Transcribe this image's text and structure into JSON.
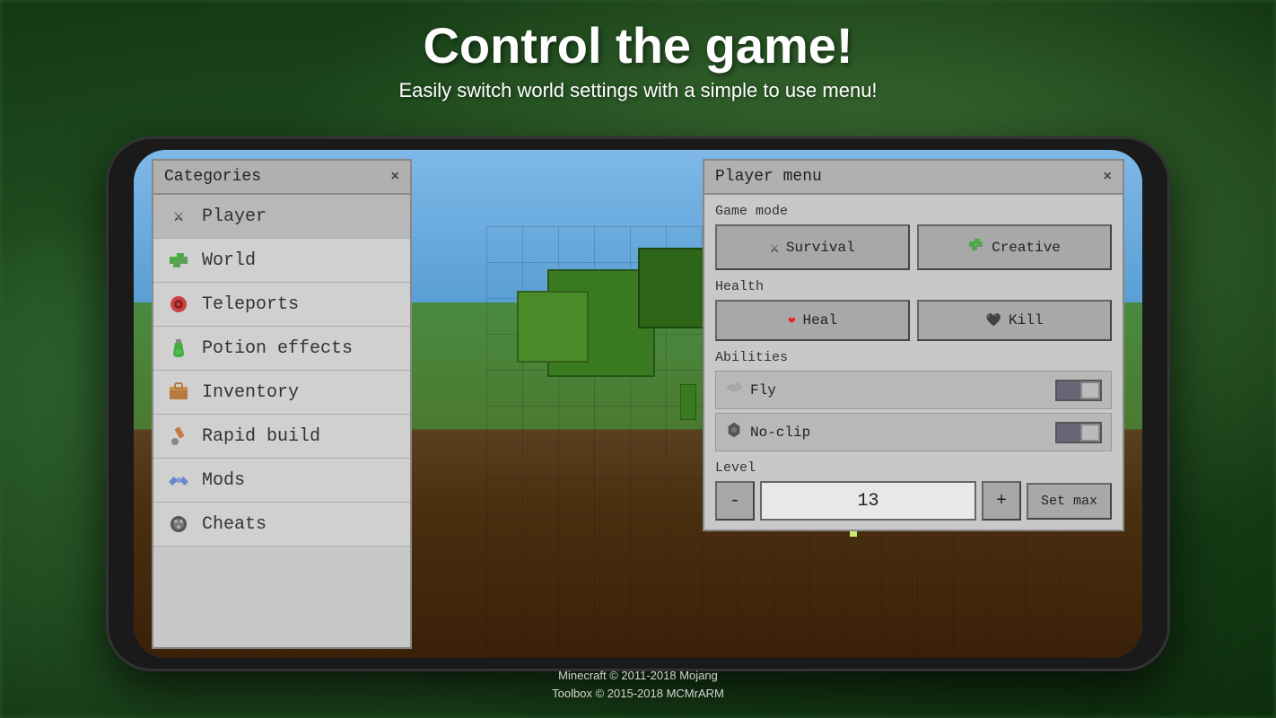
{
  "page": {
    "title": "Control the game!",
    "subtitle": "Easily switch world settings with a simple to use menu!",
    "footer_line1": "Minecraft © 2011-2018 Mojang",
    "footer_line2": "Toolbox © 2015-2018 MCMrARM"
  },
  "categories_panel": {
    "title": "Categories",
    "close": "×",
    "items": [
      {
        "id": "player",
        "label": "Player",
        "icon": "⚔"
      },
      {
        "id": "world",
        "label": "World",
        "icon": "🌍"
      },
      {
        "id": "teleports",
        "label": "Teleports",
        "icon": "🔴"
      },
      {
        "id": "potion_effects",
        "label": "Potion effects",
        "icon": "🧪"
      },
      {
        "id": "inventory",
        "label": "Inventory",
        "icon": "📦"
      },
      {
        "id": "rapid_build",
        "label": "Rapid build",
        "icon": "🔨"
      },
      {
        "id": "mods",
        "label": "Mods",
        "icon": "⚒"
      },
      {
        "id": "cheats",
        "label": "Cheats",
        "icon": "🧿"
      }
    ]
  },
  "player_panel": {
    "title": "Player menu",
    "close": "×",
    "game_mode": {
      "label": "Game mode",
      "options": [
        {
          "id": "survival",
          "label": "Survival",
          "icon": "⚔",
          "selected": false
        },
        {
          "id": "creative",
          "label": "Creative",
          "icon": "🌍",
          "selected": false
        }
      ]
    },
    "health": {
      "label": "Health",
      "actions": [
        {
          "id": "heal",
          "label": "Heal",
          "icon": "❤"
        },
        {
          "id": "kill",
          "label": "Kill",
          "icon": "🖤"
        }
      ]
    },
    "abilities": {
      "label": "Abilities",
      "items": [
        {
          "id": "fly",
          "label": "Fly",
          "icon": "✈",
          "enabled": true
        },
        {
          "id": "noclip",
          "label": "No-clip",
          "icon": "🛡",
          "enabled": true
        }
      ]
    },
    "level": {
      "label": "Level",
      "value": "13",
      "minus": "-",
      "plus": "+",
      "setmax": "Set max"
    }
  }
}
